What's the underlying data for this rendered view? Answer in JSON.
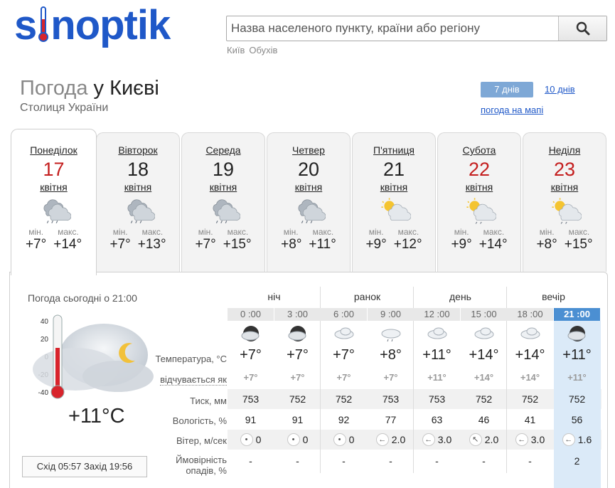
{
  "header": {
    "logo_left": "s",
    "logo_right": "noptik",
    "search_placeholder": "Назва населеного пункту, країни або регіону",
    "recent": [
      "Київ",
      "Обухів"
    ]
  },
  "title": {
    "prefix": "Погода ",
    "preposition": "у ",
    "city": "Києві",
    "subtitle": "Столиця України"
  },
  "modes": {
    "seven": "7 днів",
    "ten": "10 днів",
    "map": "погода на мапі"
  },
  "days": [
    {
      "name": "Понеділок",
      "num": "17",
      "month": "квітня",
      "min_label": "мін.",
      "max_label": "макс.",
      "min": "+7°",
      "max": "+14°",
      "red": true,
      "icon": "cloud-rain-icon"
    },
    {
      "name": "Вівторок",
      "num": "18",
      "month": "квітня",
      "min_label": "мін.",
      "max_label": "макс.",
      "min": "+7°",
      "max": "+13°",
      "red": false,
      "icon": "cloud-rain-icon"
    },
    {
      "name": "Середа",
      "num": "19",
      "month": "квітня",
      "min_label": "мін.",
      "max_label": "макс.",
      "min": "+7°",
      "max": "+15°",
      "red": false,
      "icon": "cloud-rain-icon"
    },
    {
      "name": "Четвер",
      "num": "20",
      "month": "квітня",
      "min_label": "мін.",
      "max_label": "макс.",
      "min": "+8°",
      "max": "+11°",
      "red": false,
      "icon": "cloud-rain-icon"
    },
    {
      "name": "П'ятниця",
      "num": "21",
      "month": "квітня",
      "min_label": "мін.",
      "max_label": "макс.",
      "min": "+9°",
      "max": "+12°",
      "red": false,
      "icon": "sun-cloud-icon"
    },
    {
      "name": "Субота",
      "num": "22",
      "month": "квітня",
      "min_label": "мін.",
      "max_label": "макс.",
      "min": "+9°",
      "max": "+14°",
      "red": true,
      "icon": "sun-cloud-rain-icon"
    },
    {
      "name": "Неділя",
      "num": "23",
      "month": "квітня",
      "min_label": "мін.",
      "max_label": "макс.",
      "min": "+8°",
      "max": "+15°",
      "red": true,
      "icon": "sun-cloud-rain-icon"
    }
  ],
  "today": {
    "title": "Погода сьогодні о 21:00",
    "temp": "+11°C",
    "scale": [
      "40",
      "20",
      "0",
      "-20",
      "-40"
    ],
    "sunrise_label": "Схід",
    "sunrise": "05:57",
    "sunset_label": "Захід",
    "sunset": "19:56"
  },
  "rows": {
    "temp": "Температура, °C",
    "feel": "відчувається як",
    "press": "Тиск, мм",
    "hum": "Вологість, %",
    "wind": "Вітер, м/сек",
    "precip1": "Ймовірність",
    "precip2": "опадів, %"
  },
  "periods": [
    "ніч",
    "ранок",
    "день",
    "вечір"
  ],
  "hourly": [
    {
      "time": "0 :00",
      "icon": "moon-cloud-icon",
      "temp": "+7°",
      "feel": "+7°",
      "press": "753",
      "hum": "91",
      "wind_dir": "calm",
      "wind": "0",
      "precip": "-"
    },
    {
      "time": "3 :00",
      "icon": "moon-cloud-icon",
      "temp": "+7°",
      "feel": "+7°",
      "press": "752",
      "hum": "91",
      "wind_dir": "calm",
      "wind": "0",
      "precip": "-"
    },
    {
      "time": "6 :00",
      "icon": "cloud-icon",
      "temp": "+7°",
      "feel": "+7°",
      "press": "752",
      "hum": "92",
      "wind_dir": "calm",
      "wind": "0",
      "precip": "-"
    },
    {
      "time": "9 :00",
      "icon": "cloud-drizzle-icon",
      "temp": "+8°",
      "feel": "+7°",
      "press": "753",
      "hum": "77",
      "wind_dir": "west",
      "wind": "2.0",
      "precip": "-"
    },
    {
      "time": "12 :00",
      "icon": "cloud-icon",
      "temp": "+11°",
      "feel": "+11°",
      "press": "753",
      "hum": "63",
      "wind_dir": "west",
      "wind": "3.0",
      "precip": "-"
    },
    {
      "time": "15 :00",
      "icon": "cloud-icon",
      "temp": "+14°",
      "feel": "+14°",
      "press": "752",
      "hum": "46",
      "wind_dir": "north-west",
      "wind": "2.0",
      "precip": "-"
    },
    {
      "time": "18 :00",
      "icon": "cloud-icon",
      "temp": "+14°",
      "feel": "+14°",
      "press": "752",
      "hum": "41",
      "wind_dir": "west",
      "wind": "3.0",
      "precip": "-"
    },
    {
      "time": "21 :00",
      "icon": "moon-cloud-icon",
      "temp": "+11°",
      "feel": "+11°",
      "press": "752",
      "hum": "56",
      "wind_dir": "west",
      "wind": "1.6",
      "precip": "2"
    }
  ],
  "colors": {
    "brand": "#1f58c8",
    "accent_red": "#d8242c",
    "selected_hour": "#4b8fd2",
    "highlight_column": "#dbeaf8"
  }
}
